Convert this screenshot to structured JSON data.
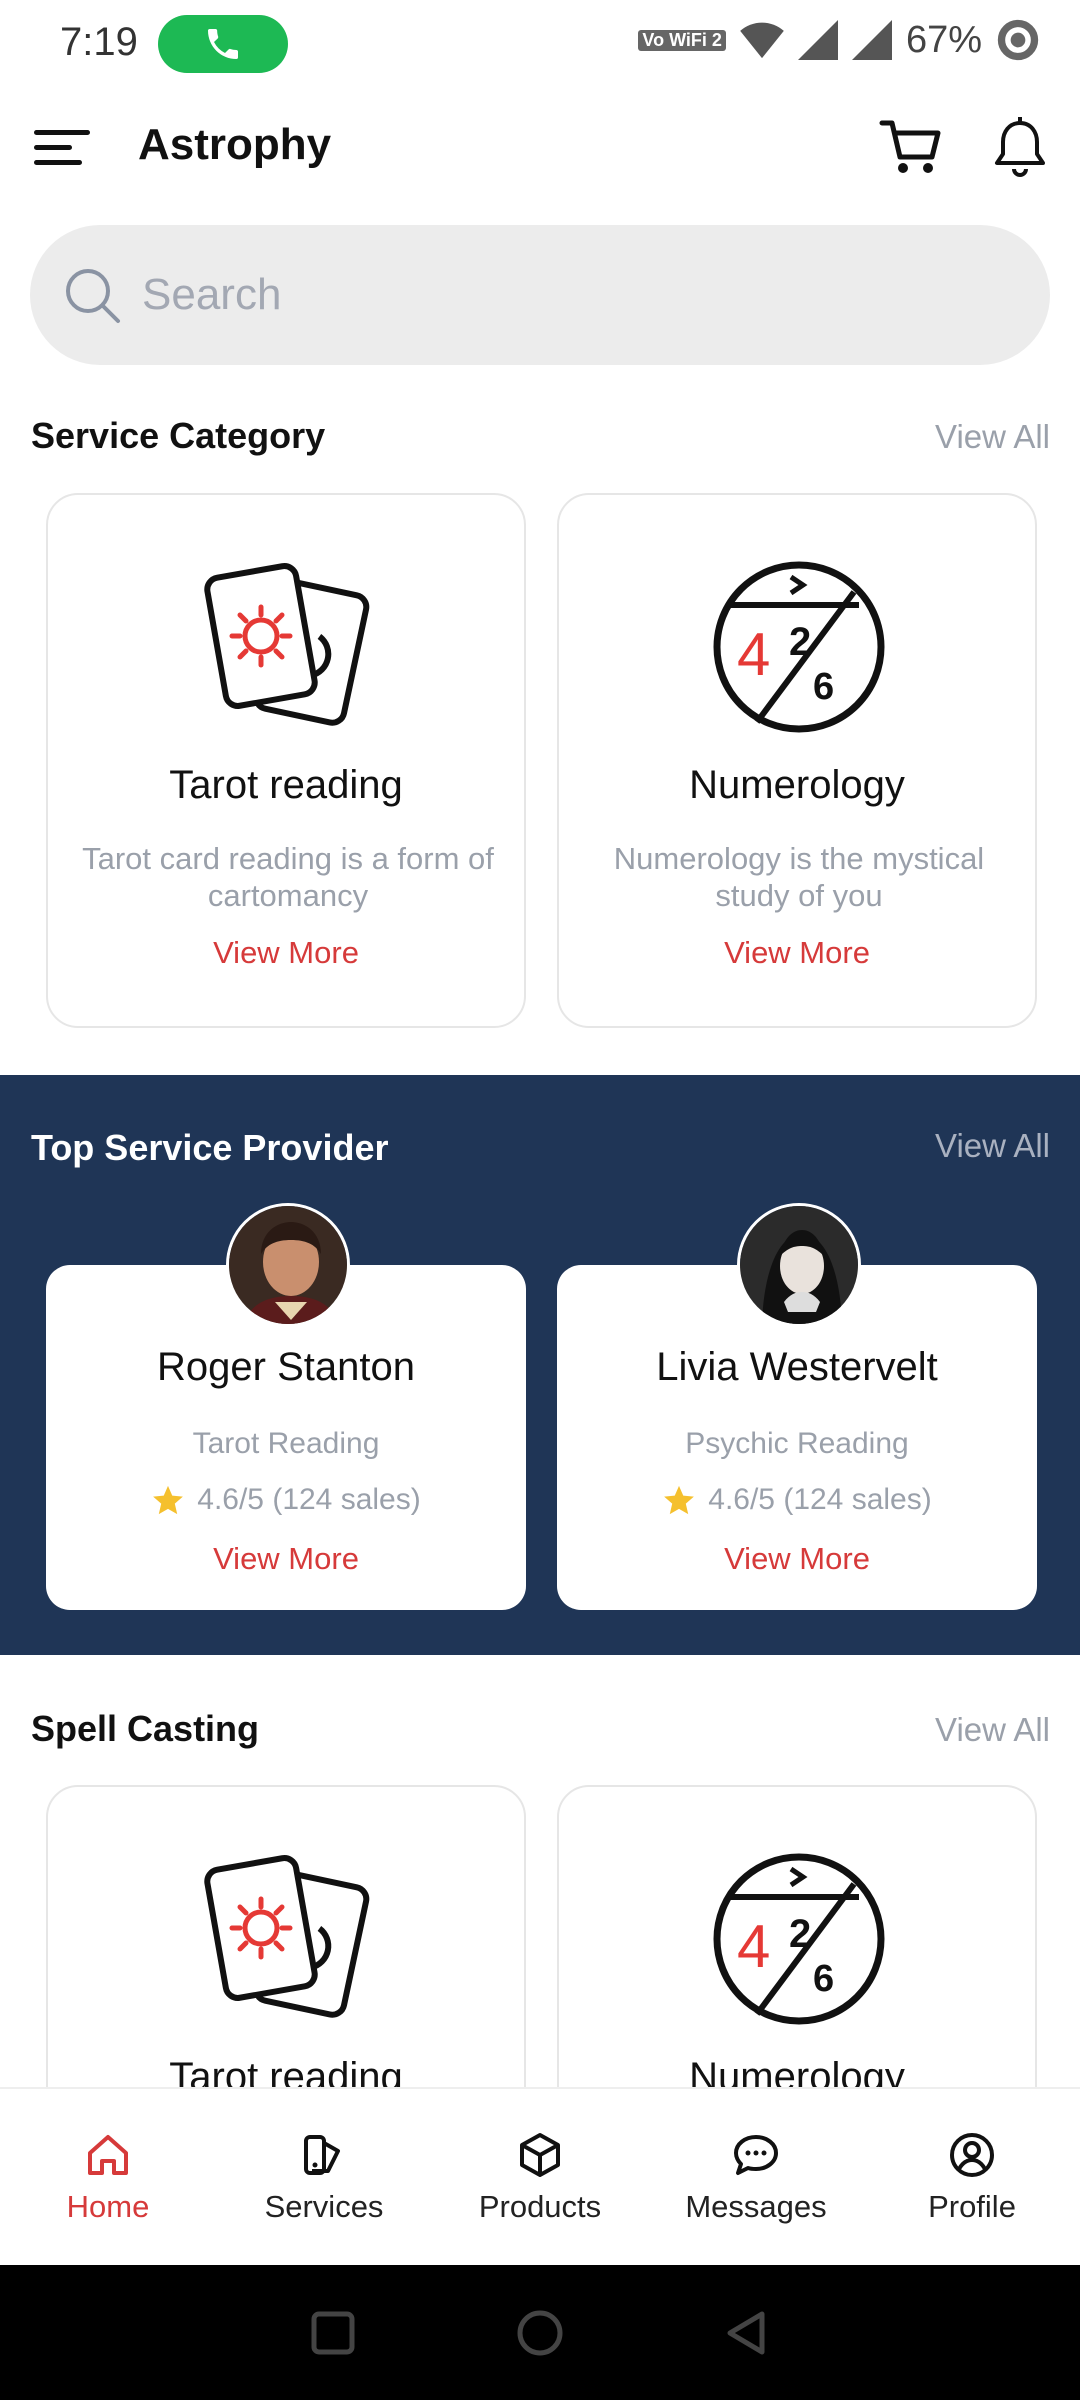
{
  "status": {
    "time": "7:19",
    "vowifi": "Vo WiFi 2",
    "battery": "67%"
  },
  "app": {
    "title": "Astrophy"
  },
  "search": {
    "placeholder": "Search"
  },
  "service_category": {
    "title": "Service Category",
    "view_all": "View All",
    "cards": [
      {
        "icon": "tarot-cards-icon",
        "title": "Tarot reading",
        "desc": "Tarot card reading is a form of cartomancy",
        "more": "View More"
      },
      {
        "icon": "numerology-icon",
        "title": "Numerology",
        "desc": "Numerology is the mystical study of you",
        "more": "View More"
      }
    ]
  },
  "top_providers": {
    "title": "Top Service Provider",
    "view_all": "View All",
    "providers": [
      {
        "name": "Roger Stanton",
        "type": "Tarot Reading",
        "rating": "4.6/5 (124 sales)",
        "more": "View More"
      },
      {
        "name": "Livia Westervelt",
        "type": "Psychic Reading",
        "rating": "4.6/5 (124 sales)",
        "more": "View More"
      }
    ]
  },
  "spell_casting": {
    "title": "Spell Casting",
    "view_all": "View All",
    "cards": [
      {
        "icon": "tarot-cards-icon",
        "title": "Tarot reading"
      },
      {
        "icon": "numerology-icon",
        "title": "Numerology"
      }
    ]
  },
  "bottom_nav": [
    {
      "label": "Home",
      "icon": "home-icon",
      "active": true
    },
    {
      "label": "Services",
      "icon": "services-icon"
    },
    {
      "label": "Products",
      "icon": "box-icon"
    },
    {
      "label": "Messages",
      "icon": "chat-icon"
    },
    {
      "label": "Profile",
      "icon": "profile-icon"
    }
  ],
  "colors": {
    "accent": "#d63a3a",
    "band": "#1f3556",
    "star": "#f5c02e"
  }
}
